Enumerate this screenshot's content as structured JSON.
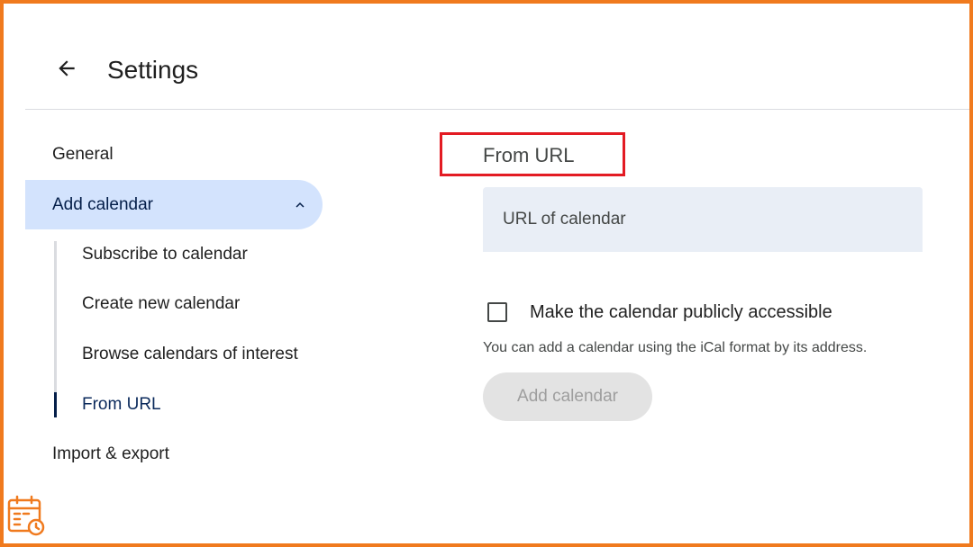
{
  "header": {
    "title": "Settings",
    "back_icon": "arrow-left-icon"
  },
  "sidebar": {
    "general": "General",
    "add_calendar": "Add calendar",
    "sub_items": [
      {
        "label": "Subscribe to calendar"
      },
      {
        "label": "Create new calendar"
      },
      {
        "label": "Browse calendars of interest"
      },
      {
        "label": "From URL",
        "selected": true
      }
    ],
    "import_export": "Import & export"
  },
  "main": {
    "section_title": "From URL",
    "url_placeholder": "URL of calendar",
    "url_value": "",
    "public_checkbox_label": "Make the calendar publicly accessible",
    "public_checked": false,
    "helper_text": "You can add a calendar using the iCal format by its address.",
    "add_button_label": "Add calendar"
  },
  "colors": {
    "frame": "#f07a1e",
    "highlight": "#e31b23",
    "active_nav_bg": "#d3e3fd",
    "input_bg": "#e9eef6"
  }
}
